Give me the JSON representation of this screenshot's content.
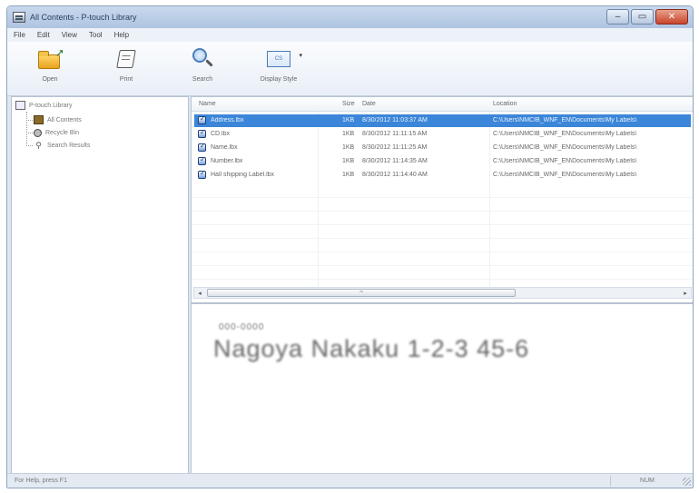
{
  "window": {
    "title": "All Contents - P-touch Library",
    "minimize_glyph": "–",
    "maximize_glyph": "▭",
    "close_glyph": "✕",
    "close_color": "#c9452b"
  },
  "menu": [
    "File",
    "Edit",
    "View",
    "Tool",
    "Help"
  ],
  "toolbar": {
    "open": {
      "label": "Open",
      "icon": "open-folder-icon"
    },
    "print": {
      "label": "Print",
      "icon": "print-icon"
    },
    "search": {
      "label": "Search",
      "icon": "search-icon"
    },
    "display": {
      "label": "Display Style",
      "icon": "display-style-icon",
      "icon_text": "CS",
      "arrow": "▾"
    }
  },
  "tree": {
    "root": "P-touch Library",
    "items": [
      {
        "label": "All Contents",
        "icon": "folder-icon"
      },
      {
        "label": "Recycle Bin",
        "icon": "recycle-bin-icon"
      },
      {
        "label": "Search Results",
        "icon": "search-icon"
      }
    ]
  },
  "list": {
    "columns": [
      "Name",
      "Size",
      "Date",
      "Location"
    ],
    "selected_color": "#3b86d8",
    "rows": [
      {
        "name": "Address.lbx",
        "size": "1KB",
        "date": "8/30/2012 11:03:37 AM",
        "location": "C:\\Users\\NMCIB_WNF_EN\\Documents\\My Labels\\",
        "selected": true
      },
      {
        "name": "CD.lbx",
        "size": "1KB",
        "date": "8/30/2012 11:11:15 AM",
        "location": "C:\\Users\\NMCIB_WNF_EN\\Documents\\My Labels\\"
      },
      {
        "name": "Name.lbx",
        "size": "1KB",
        "date": "8/30/2012 11:11:25 AM",
        "location": "C:\\Users\\NMCIB_WNF_EN\\Documents\\My Labels\\"
      },
      {
        "name": "Number.lbx",
        "size": "1KB",
        "date": "8/30/2012 11:14:35 AM",
        "location": "C:\\Users\\NMCIB_WNF_EN\\Documents\\My Labels\\"
      },
      {
        "name": "Hall shipping Label.lbx",
        "size": "1KB",
        "date": "8/30/2012 11:14:40 AM",
        "location": "C:\\Users\\NMCIB_WNF_EN\\Documents\\My Labels\\"
      }
    ],
    "scroll_left": "◂",
    "scroll_right": "▸",
    "scroll_grip": "┅"
  },
  "preview": {
    "code": "000-0000",
    "address": "Nagoya Nakaku 1-2-3 45-6"
  },
  "status": {
    "left": "For Help, press F1",
    "right": "NUM"
  }
}
